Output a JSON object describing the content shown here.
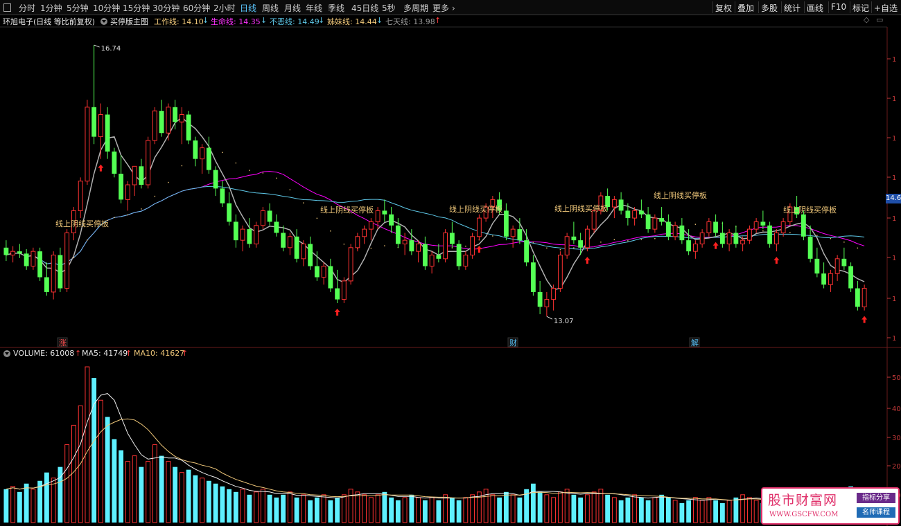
{
  "toolbar": {
    "periods": [
      "分时",
      "1分钟",
      "5分钟",
      "10分钟",
      "15分钟",
      "30分钟",
      "60分钟",
      "2小时",
      "日线",
      "周线",
      "月线",
      "年线",
      "季线",
      "45日线",
      "5秒",
      "多周期",
      "更多"
    ],
    "active_period": "日线",
    "right_buttons": [
      "复权",
      "叠加",
      "多股",
      "统计",
      "画线",
      "F10",
      "标记",
      "+自选"
    ]
  },
  "info": {
    "stock": "环旭电子(日线 等比前复权)",
    "indicator_name": "买停版主图",
    "work_line": "工作线: 14.10",
    "life_line": "生命线: 14.35",
    "nohate_line": "不恶线: 14.49",
    "sister_line": "姊妹线: 14.44",
    "seven_line": "七天线: 13.98",
    "arrow_down": "↓",
    "arrow_up": "↑"
  },
  "volume_info": {
    "volume": "VOLUME: 61008",
    "ma5": "MA5: 41749",
    "ma10": "MA10: 41627",
    "arrow_up": "↑"
  },
  "chart_data": {
    "type": "candlestick",
    "high_label": "16.74",
    "low_label": "13.07",
    "last_price_label": "14.6",
    "pattern_label": "线上阴线买停板",
    "event_markers": [
      "涨",
      "财",
      "解"
    ],
    "price_axis_label": "1",
    "volume_axis_labels": [
      "50",
      "40",
      "30",
      "20",
      "10"
    ],
    "ohlc": [
      [
        14.0,
        14.1,
        13.82,
        13.9
      ],
      [
        13.9,
        14.02,
        13.8,
        13.95
      ],
      [
        13.95,
        14.05,
        13.86,
        13.92
      ],
      [
        13.92,
        13.98,
        13.7,
        13.75
      ],
      [
        13.75,
        14.0,
        13.7,
        13.95
      ],
      [
        13.95,
        14.0,
        13.55,
        13.6
      ],
      [
        13.6,
        13.8,
        13.35,
        13.4
      ],
      [
        13.4,
        13.95,
        13.3,
        13.9
      ],
      [
        13.9,
        14.0,
        13.4,
        13.45
      ],
      [
        13.45,
        14.25,
        13.4,
        14.2
      ],
      [
        14.2,
        14.55,
        14.1,
        14.5
      ],
      [
        14.5,
        14.95,
        14.4,
        14.9
      ],
      [
        14.9,
        16.0,
        14.85,
        15.9
      ],
      [
        15.9,
        16.74,
        15.4,
        15.5
      ],
      [
        15.5,
        15.95,
        15.2,
        15.8
      ],
      [
        15.8,
        15.9,
        15.2,
        15.3
      ],
      [
        15.3,
        15.35,
        14.95,
        15.0
      ],
      [
        15.0,
        15.25,
        14.6,
        14.65
      ],
      [
        14.65,
        14.9,
        14.5,
        14.85
      ],
      [
        14.85,
        15.1,
        14.7,
        15.1
      ],
      [
        15.1,
        15.2,
        14.8,
        14.85
      ],
      [
        14.85,
        15.5,
        14.8,
        15.45
      ],
      [
        15.45,
        15.9,
        15.4,
        15.85
      ],
      [
        15.85,
        16.0,
        15.5,
        15.55
      ],
      [
        15.55,
        15.95,
        15.45,
        15.9
      ],
      [
        15.9,
        16.0,
        15.6,
        15.7
      ],
      [
        15.7,
        15.9,
        15.4,
        15.8
      ],
      [
        15.8,
        15.85,
        15.4,
        15.45
      ],
      [
        15.45,
        15.5,
        15.1,
        15.2
      ],
      [
        15.2,
        15.4,
        15.0,
        15.35
      ],
      [
        15.35,
        15.5,
        15.0,
        15.05
      ],
      [
        15.05,
        15.1,
        14.7,
        14.8
      ],
      [
        14.8,
        14.9,
        14.55,
        14.6
      ],
      [
        14.6,
        14.75,
        14.3,
        14.35
      ],
      [
        14.35,
        14.45,
        14.0,
        14.1
      ],
      [
        14.1,
        14.3,
        13.95,
        14.25
      ],
      [
        14.25,
        14.4,
        14.0,
        14.05
      ],
      [
        14.05,
        14.35,
        14.0,
        14.3
      ],
      [
        14.3,
        14.55,
        14.25,
        14.5
      ],
      [
        14.5,
        14.6,
        14.3,
        14.35
      ],
      [
        14.35,
        14.45,
        14.15,
        14.2
      ],
      [
        14.2,
        14.3,
        13.95,
        14.0
      ],
      [
        14.0,
        14.2,
        13.9,
        14.15
      ],
      [
        14.15,
        14.25,
        13.8,
        13.85
      ],
      [
        13.85,
        14.1,
        13.75,
        14.05
      ],
      [
        14.05,
        14.15,
        13.7,
        13.75
      ],
      [
        13.75,
        13.95,
        13.55,
        13.6
      ],
      [
        13.6,
        13.8,
        13.5,
        13.75
      ],
      [
        13.75,
        13.85,
        13.4,
        13.45
      ],
      [
        13.45,
        13.7,
        13.25,
        13.3
      ],
      [
        13.3,
        13.6,
        13.25,
        13.55
      ],
      [
        13.55,
        14.05,
        13.5,
        14.0
      ],
      [
        14.0,
        14.2,
        13.95,
        14.15
      ],
      [
        14.15,
        14.3,
        14.05,
        14.25
      ],
      [
        14.25,
        14.4,
        14.1,
        14.35
      ],
      [
        14.35,
        14.55,
        14.25,
        14.5
      ],
      [
        14.5,
        14.65,
        14.35,
        14.45
      ],
      [
        14.45,
        14.55,
        14.2,
        14.3
      ],
      [
        14.3,
        14.4,
        14.0,
        14.05
      ],
      [
        14.05,
        14.2,
        13.9,
        14.1
      ],
      [
        14.1,
        14.25,
        13.9,
        13.95
      ],
      [
        13.95,
        14.1,
        13.8,
        14.05
      ],
      [
        14.05,
        14.15,
        13.7,
        13.75
      ],
      [
        13.75,
        13.95,
        13.65,
        13.9
      ],
      [
        13.9,
        14.05,
        13.8,
        13.85
      ],
      [
        13.85,
        14.25,
        13.8,
        14.2
      ],
      [
        14.2,
        14.35,
        14.0,
        14.05
      ],
      [
        14.05,
        14.1,
        13.7,
        13.75
      ],
      [
        13.75,
        13.95,
        13.7,
        13.9
      ],
      [
        13.9,
        14.2,
        13.85,
        14.15
      ],
      [
        14.15,
        14.45,
        14.1,
        14.4
      ],
      [
        14.4,
        14.6,
        14.35,
        14.55
      ],
      [
        14.55,
        14.7,
        14.4,
        14.65
      ],
      [
        14.65,
        14.75,
        14.45,
        14.5
      ],
      [
        14.5,
        14.6,
        14.1,
        14.15
      ],
      [
        14.15,
        14.3,
        14.0,
        14.25
      ],
      [
        14.25,
        14.4,
        14.05,
        14.1
      ],
      [
        14.1,
        14.25,
        13.75,
        13.8
      ],
      [
        13.8,
        13.9,
        13.35,
        13.4
      ],
      [
        13.4,
        13.55,
        13.1,
        13.2
      ],
      [
        13.2,
        13.4,
        13.07,
        13.3
      ],
      [
        13.3,
        13.5,
        13.15,
        13.45
      ],
      [
        13.45,
        13.95,
        13.4,
        13.9
      ],
      [
        13.9,
        14.2,
        13.85,
        14.15
      ],
      [
        14.15,
        14.35,
        14.05,
        14.1
      ],
      [
        14.1,
        14.2,
        13.9,
        14.0
      ],
      [
        14.0,
        14.3,
        13.95,
        14.25
      ],
      [
        14.25,
        14.55,
        14.2,
        14.5
      ],
      [
        14.5,
        14.75,
        14.45,
        14.7
      ],
      [
        14.7,
        14.8,
        14.5,
        14.55
      ],
      [
        14.55,
        14.7,
        14.4,
        14.65
      ],
      [
        14.65,
        14.75,
        14.45,
        14.5
      ],
      [
        14.5,
        14.6,
        14.3,
        14.4
      ],
      [
        14.4,
        14.55,
        14.3,
        14.5
      ],
      [
        14.5,
        14.65,
        14.4,
        14.45
      ],
      [
        14.45,
        14.55,
        14.2,
        14.25
      ],
      [
        14.25,
        14.45,
        14.2,
        14.4
      ],
      [
        14.4,
        14.55,
        14.3,
        14.35
      ],
      [
        14.35,
        14.45,
        14.1,
        14.15
      ],
      [
        14.15,
        14.35,
        14.1,
        14.3
      ],
      [
        14.3,
        14.4,
        14.05,
        14.1
      ],
      [
        14.1,
        14.25,
        13.9,
        13.95
      ],
      [
        13.95,
        14.1,
        13.85,
        14.05
      ],
      [
        14.05,
        14.25,
        14.0,
        14.2
      ],
      [
        14.2,
        14.4,
        14.15,
        14.35
      ],
      [
        14.35,
        14.45,
        14.15,
        14.2
      ],
      [
        14.2,
        14.35,
        14.0,
        14.05
      ],
      [
        14.05,
        14.25,
        13.95,
        14.2
      ],
      [
        14.2,
        14.3,
        14.0,
        14.05
      ],
      [
        14.05,
        14.15,
        13.95,
        14.1
      ],
      [
        14.1,
        14.3,
        14.05,
        14.25
      ],
      [
        14.25,
        14.4,
        14.2,
        14.35
      ],
      [
        14.35,
        14.5,
        14.25,
        14.3
      ],
      [
        14.3,
        14.35,
        14.0,
        14.05
      ],
      [
        14.05,
        14.25,
        13.95,
        14.2
      ],
      [
        14.2,
        14.4,
        14.15,
        14.35
      ],
      [
        14.35,
        14.6,
        14.3,
        14.55
      ],
      [
        14.55,
        14.7,
        14.4,
        14.45
      ],
      [
        14.45,
        14.5,
        14.1,
        14.15
      ],
      [
        14.15,
        14.3,
        13.8,
        13.85
      ],
      [
        13.85,
        14.0,
        13.6,
        13.65
      ],
      [
        13.65,
        13.8,
        13.45,
        13.5
      ],
      [
        13.5,
        13.7,
        13.4,
        13.65
      ],
      [
        13.65,
        13.9,
        13.55,
        13.85
      ],
      [
        13.85,
        14.0,
        13.7,
        13.75
      ],
      [
        13.75,
        13.8,
        13.4,
        13.45
      ],
      [
        13.45,
        13.55,
        13.15,
        13.2
      ],
      [
        13.2,
        13.5,
        13.15,
        13.45
      ]
    ],
    "volume": [
      12,
      13,
      11,
      14,
      12,
      15,
      18,
      16,
      20,
      28,
      35,
      42,
      56,
      52,
      44,
      38,
      30,
      26,
      22,
      24,
      20,
      22,
      28,
      24,
      22,
      20,
      18,
      19,
      17,
      16,
      15,
      14,
      13,
      12,
      11,
      12,
      10,
      11,
      12,
      10,
      9,
      10,
      11,
      9,
      10,
      8,
      9,
      10,
      8,
      9,
      10,
      12,
      11,
      10,
      9,
      10,
      11,
      9,
      8,
      9,
      10,
      9,
      8,
      9,
      8,
      10,
      9,
      8,
      9,
      10,
      11,
      12,
      10,
      9,
      11,
      10,
      9,
      12,
      14,
      11,
      10,
      9,
      11,
      12,
      10,
      9,
      10,
      11,
      12,
      10,
      9,
      8,
      9,
      10,
      9,
      8,
      9,
      10,
      9,
      8,
      7,
      8,
      9,
      8,
      9,
      8,
      7,
      8,
      9,
      10,
      9,
      8,
      7,
      8,
      9,
      10,
      12,
      11,
      10,
      9,
      10,
      11,
      9,
      8,
      10,
      13,
      12
    ]
  },
  "colors": {
    "up": "#ff3232",
    "down": "#54ff54",
    "grid": "#3a0a0a",
    "axis_text": "#c83a3a",
    "life": "#ff00ff",
    "nohate": "#5ec8e8",
    "sister": "#f0c87a",
    "work": "#f0c87a",
    "seven": "#999999",
    "active": "#5bc7ff"
  }
}
